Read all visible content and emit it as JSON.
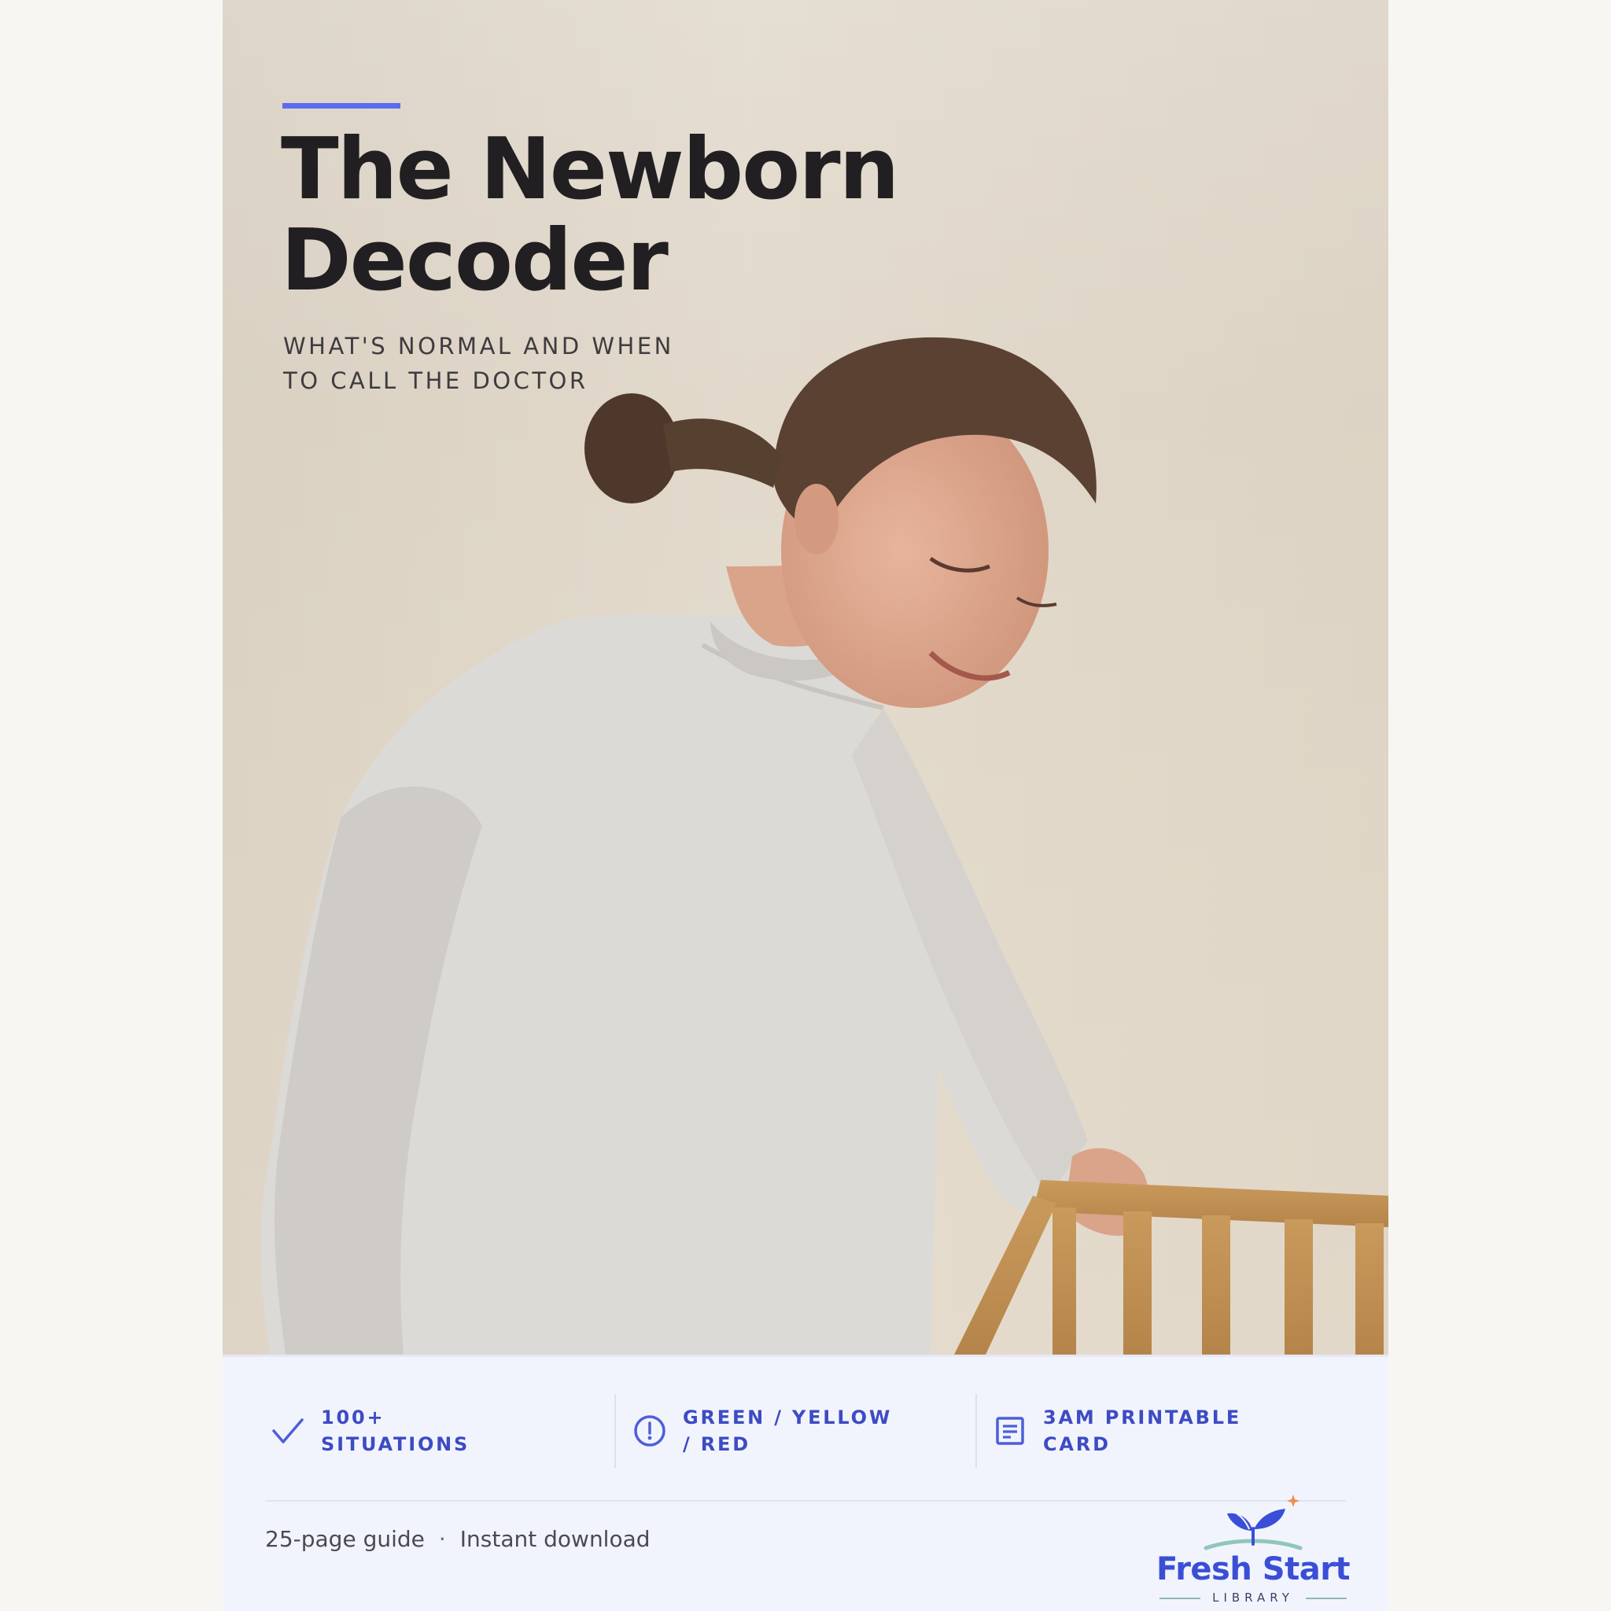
{
  "cover": {
    "title_line1": "The Newborn",
    "title_line2": "Decoder",
    "subtitle_line1": "WHAT'S NORMAL AND WHEN",
    "subtitle_line2": "TO CALL THE DOCTOR"
  },
  "features": [
    {
      "icon": "check-icon",
      "line1": "100+",
      "line2": "SITUATIONS"
    },
    {
      "icon": "alert-circle-icon",
      "line1": "GREEN / YELLOW",
      "line2": "/ RED"
    },
    {
      "icon": "document-icon",
      "line1": "3AM PRINTABLE",
      "line2": "CARD"
    }
  ],
  "meta": {
    "pages": "25-page guide",
    "separator": "·",
    "delivery": "Instant download"
  },
  "brand": {
    "name": "Fresh Start",
    "sub": "LIBRARY",
    "icon": "sprout-icon"
  },
  "colors": {
    "accent": "#5a6cf0",
    "feature_text": "#3d4bc4",
    "title": "#211f22",
    "panel_bg": "#f2f4fd",
    "brand_blue": "#3a4fd6",
    "spark_orange": "#f08a4b"
  }
}
